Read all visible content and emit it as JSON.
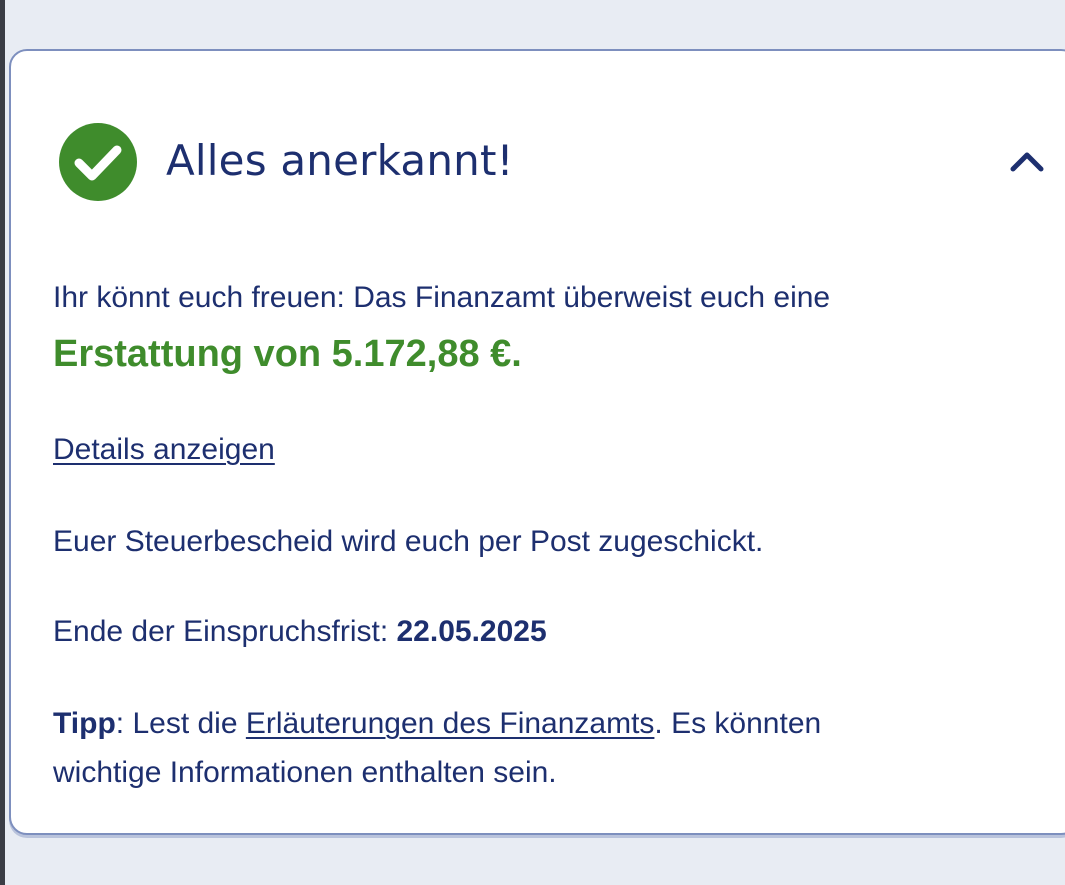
{
  "card": {
    "title": "Alles anerkannt!",
    "message_intro": "Ihr könnt euch freuen: Das Finanzamt überweist euch eine",
    "refund_text": "Erstattung von 5.172,88 €.",
    "details_link": "Details anzeigen",
    "post_notice": "Euer Steuerbescheid wird euch per Post zugeschickt.",
    "deadline_label": "Ende der Einspruchsfrist: ",
    "deadline_date": "22.05.2025",
    "tip_label": "Tipp",
    "tip_text_1": ": Lest die ",
    "tip_link": "Erläuterungen des Finanzamts",
    "tip_text_2": ". Es könnten",
    "tip_text_3": "wichtige Informationen enthalten sein."
  },
  "icons": {
    "status": "check-circle-icon",
    "toggle": "chevron-up-icon"
  },
  "colors": {
    "primary_text": "#1d2f6f",
    "success_green": "#3f8c2c",
    "card_border": "#7d8fbe",
    "background": "#e8ecf3"
  }
}
